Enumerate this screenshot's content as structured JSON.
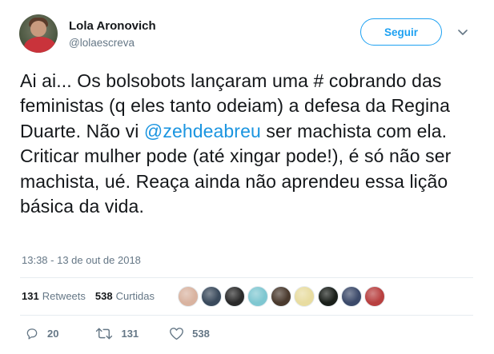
{
  "author": {
    "name": "Lola Aronovich",
    "handle": "@lolaescreva"
  },
  "follow_button": {
    "label": "Seguir"
  },
  "tweet": {
    "text_before": "Ai ai... Os bolsobots lançaram uma # cobrando das feministas (q eles tanto odeiam) a defesa da Regina Duarte. Não vi ",
    "mention": "@zehdeabreu",
    "text_after": " ser machista com ela. Criticar mulher pode (até xingar pode!), é só não ser machista, ué. Reaça ainda não aprendeu essa lição básica da vida.",
    "timestamp": "13:38 - 13 de out de 2018"
  },
  "stats": {
    "retweets_count": "131",
    "retweets_label": "Retweets",
    "likes_count": "538",
    "likes_label": "Curtidas"
  },
  "liker_avatars": [
    {
      "color": "#d9b3a0"
    },
    {
      "color": "#3a4a5c"
    },
    {
      "color": "#2a2a2a"
    },
    {
      "color": "#7fc7d1"
    },
    {
      "color": "#4a3a2e"
    },
    {
      "color": "#e8dca0"
    },
    {
      "color": "#1a1f1a"
    },
    {
      "color": "#3c4a6a"
    },
    {
      "color": "#b84040"
    }
  ],
  "actions": {
    "reply_count": "20",
    "retweet_count": "131",
    "like_count": "538"
  },
  "colors": {
    "accent": "#1da1f2",
    "mention": "#1b95e0",
    "muted": "#657786"
  }
}
